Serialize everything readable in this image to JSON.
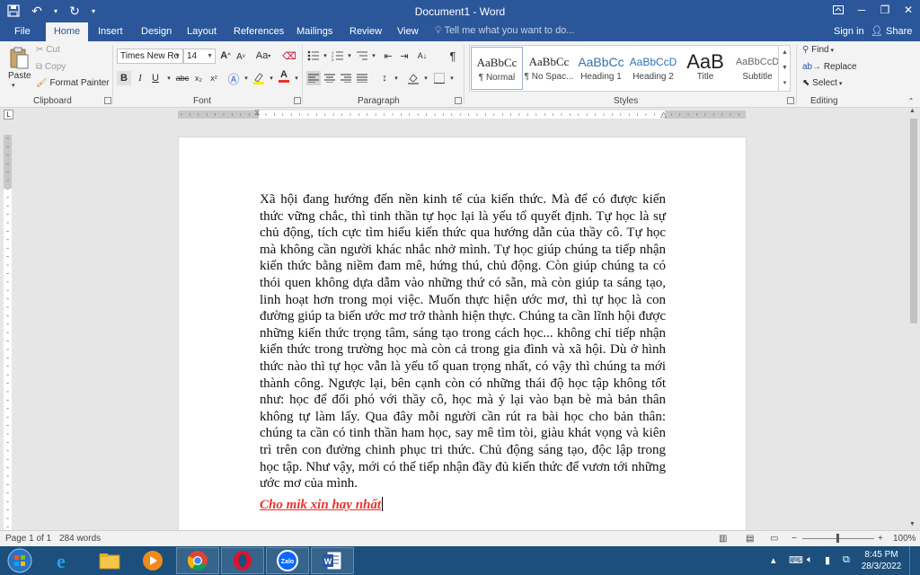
{
  "window": {
    "title": "Document1 - Word",
    "signin": "Sign in",
    "share": "Share"
  },
  "tabs": [
    "File",
    "Home",
    "Insert",
    "Design",
    "Layout",
    "References",
    "Mailings",
    "Review",
    "View"
  ],
  "active_tab": "Home",
  "tellme": "Tell me what you want to do...",
  "clipboard": {
    "paste": "Paste",
    "cut": "Cut",
    "copy": "Copy",
    "format_painter": "Format Painter",
    "label": "Clipboard"
  },
  "font": {
    "family": "Times New Ro",
    "size": "14",
    "bold": "B",
    "italic": "I",
    "underline": "U",
    "strike": "abc",
    "subscript": "x₂",
    "superscript": "x²",
    "grow": "A",
    "shrink": "A",
    "case": "Aa",
    "color_letter": "A",
    "label": "Font"
  },
  "paragraph": {
    "label": "Paragraph",
    "pilcrow": "¶"
  },
  "styles": {
    "label": "Styles",
    "items": [
      {
        "sample": "AaBbCc",
        "name": "¶ Normal"
      },
      {
        "sample": "AaBbCc",
        "name": "¶ No Spac..."
      },
      {
        "sample": "AaBbCc",
        "name": "Heading 1"
      },
      {
        "sample": "AaBbCcD",
        "name": "Heading 2"
      },
      {
        "sample": "AaB",
        "name": "Title"
      },
      {
        "sample": "AaBbCcD",
        "name": "Subtitle"
      }
    ],
    "selected": "¶ Normal"
  },
  "editing": {
    "label": "Editing",
    "find": "Find",
    "replace": "Replace",
    "select": "Select"
  },
  "document": {
    "body": "Xã hội đang hướng đến nền kinh tế của kiến thức. Mà để có được kiến thức vững chắc, thì tinh thần tự học lại là yếu tố quyết định. Tự học là sự chủ động, tích cực tìm hiểu kiến thức qua hướng dẫn của thầy cô. Tự học mà không cần người khác nhắc nhở mình. Tự học giúp chúng ta tiếp nhận kiến thức bằng niềm đam mê, hứng thú, chủ động. Còn giúp chúng ta có thói quen không dựa dẫm vào những thứ có sẵn, mà còn giúp ta sáng tạo, linh hoạt hơn trong mọi việc. Muốn thực hiện ước mơ, thì tự học là con đường giúp ta biến ước mơ trở thành hiện thực. Chúng ta cần lĩnh hội được những kiến thức trọng tâm, sáng tạo trong cách học... không chỉ tiếp nhận kiến thức trong trường học mà còn cả trong gia đình và xã hội. Dù ở hình thức nào thì tự học vẫn là yếu tố quan trọng nhất, có vậy thì chúng ta mới thành công. Ngược lại, bên cạnh còn có những thái độ học tập không tốt như: học để đối phó với thầy cô, học mà ỷ lại vào bạn bè mà bản thân không tự làm lấy. Qua đây mỗi người cần rút ra bài học cho bản thân: chúng ta cần có tinh thần ham học, say mê tìm tòi, giàu khát vọng và kiên trì trên con đường chinh phục tri thức. Chủ động sáng tạo, độc lập trong học tập. Như vậy, mới có thể tiếp nhận đầy đủ kiến thức để vươn tới những ước mơ của mình.",
    "signoff": "Cho mik xin hay nhất"
  },
  "status": {
    "page": "Page 1 of 1",
    "words": "284 words",
    "zoom": "100%",
    "zoom_level": 1.0
  },
  "taskbar": {
    "time": "8:45 PM",
    "date": "28/3/2022",
    "apps": [
      "start-icon",
      "internet-explorer-icon",
      "file-explorer-icon",
      "media-player-icon",
      "chrome-icon",
      "opera-icon",
      "zalo-icon",
      "word-icon"
    ],
    "zalo_label": "Zalo",
    "word_label": "W"
  },
  "colors": {
    "accent": "#2b579a",
    "signoff": "#e8332d",
    "taskbar": "#1c4f7c"
  }
}
